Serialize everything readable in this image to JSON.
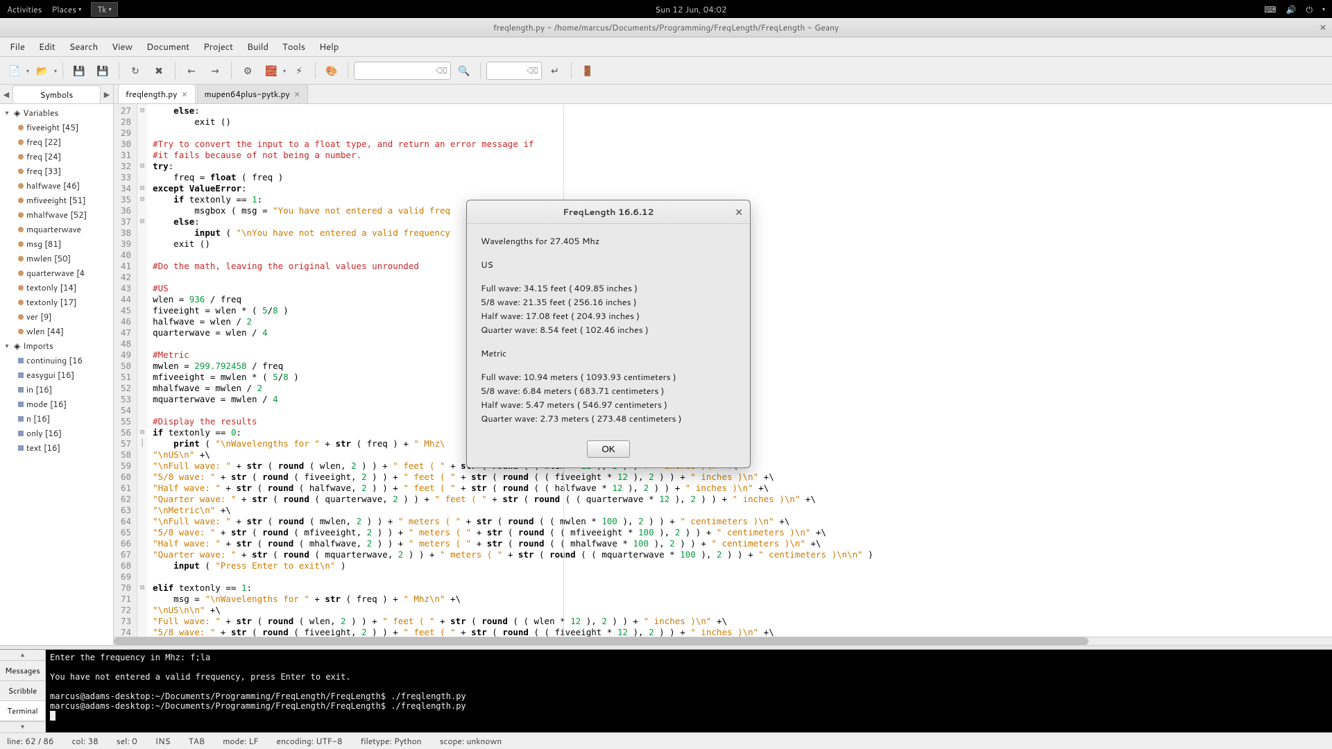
{
  "gnome": {
    "activities": "Activities",
    "places": "Places",
    "tk": "Tk",
    "clock": "Sun 12 Jun, 04:02"
  },
  "window": {
    "title": "freqlength.py - /home/marcus/Documents/Programming/FreqLength/FreqLength - Geany"
  },
  "menu": {
    "file": "File",
    "edit": "Edit",
    "search": "Search",
    "view": "View",
    "document": "Document",
    "project": "Project",
    "build": "Build",
    "tools": "Tools",
    "help": "Help"
  },
  "sidebar": {
    "tab": "Symbols",
    "groups": {
      "variables": "Variables",
      "imports": "Imports"
    },
    "variables": [
      "fiveeight [45]",
      "freq [22]",
      "freq [24]",
      "freq [33]",
      "halfwave [46]",
      "mfiveeight [51]",
      "mhalfwave [52]",
      "mquarterwave",
      "msg [81]",
      "mwlen [50]",
      "quarterwave [4",
      "textonly [14]",
      "textonly [17]",
      "ver [9]",
      "wlen [44]"
    ],
    "imports": [
      "continuing [16",
      "easygui [16]",
      "in [16]",
      "mode [16]",
      "n [16]",
      "only [16]",
      "text [16]"
    ]
  },
  "filetabs": {
    "tab1": "freqlength.py",
    "tab2": "mupen64plus-pytk.py"
  },
  "editor": {
    "first_line": 27
  },
  "dialog": {
    "title": "FreqLength 16.6.12",
    "header": "Wavelengths for 27.405 Mhz",
    "us_label": "US",
    "us_full": "Full wave: 34.15 feet ( 409.85 inches )",
    "us_58": "5/8 wave: 21.35 feet ( 256.16 inches )",
    "us_half": "Half wave: 17.08 feet ( 204.93 inches )",
    "us_quarter": "Quarter wave: 8.54 feet ( 102.46 inches )",
    "metric_label": "Metric",
    "m_full": "Full wave: 10.94 meters ( 1093.93 centimeters )",
    "m_58": "5/8 wave: 6.84 meters ( 683.71 centimeters )",
    "m_half": "Half wave: 5.47 meters ( 546.97 centimeters )",
    "m_quarter": "Quarter wave: 2.73 meters ( 273.48 centimeters )",
    "ok": "OK"
  },
  "terminal": {
    "line1": "Enter the frequency in Mhz: f;la",
    "line2": "",
    "line3": "You have not entered a valid frequency, press Enter to exit.",
    "line4": "",
    "line5": "marcus@adams-desktop:~/Documents/Programming/FreqLength/FreqLength$ ./freqlength.py",
    "line6": "marcus@adams-desktop:~/Documents/Programming/FreqLength/FreqLength$ ./freqlength.py"
  },
  "bottom_tabs": {
    "messages": "Messages",
    "scribble": "Scribble",
    "terminal": "Terminal"
  },
  "status": {
    "line": "line: 62 / 86",
    "col": "col: 38",
    "sel": "sel: 0",
    "ins": "INS",
    "tab": "TAB",
    "mode": "mode: LF",
    "encoding": "encoding: UTF-8",
    "filetype": "filetype: Python",
    "scope": "scope: unknown"
  }
}
